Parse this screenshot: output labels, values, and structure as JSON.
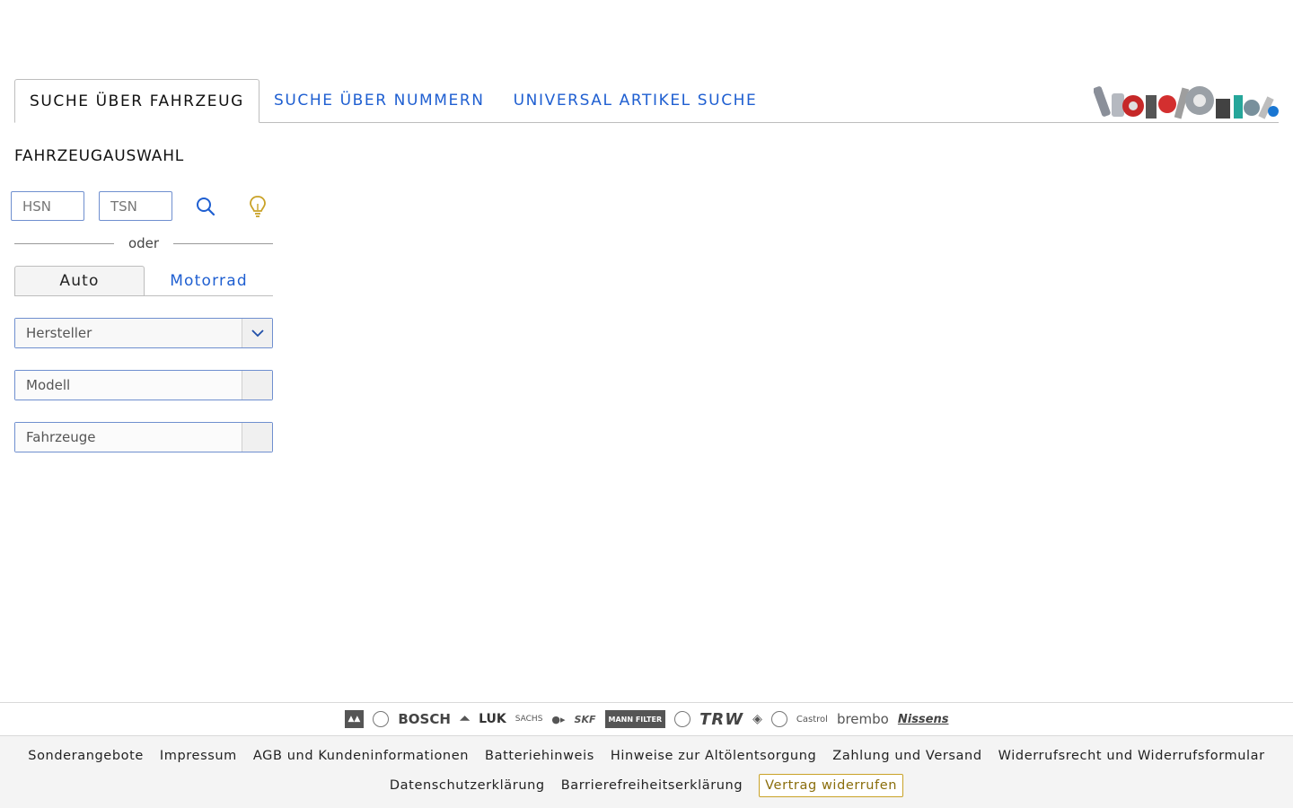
{
  "tabs": [
    {
      "label": "SUCHE ÜBER FAHRZEUG",
      "active": true
    },
    {
      "label": "SUCHE ÜBER NUMMERN",
      "active": false
    },
    {
      "label": "UNIVERSAL ARTIKEL SUCHE",
      "active": false
    }
  ],
  "vehicle": {
    "title": "FAHRZEUGAUSWAHL",
    "hsn_placeholder": "HSN",
    "tsn_placeholder": "TSN",
    "divider_text": "oder",
    "segments": [
      {
        "label": "Auto",
        "active": true
      },
      {
        "label": "Motorrad",
        "active": false
      }
    ],
    "selects": [
      {
        "label": "Hersteller",
        "enabled": true
      },
      {
        "label": "Modell",
        "enabled": false
      },
      {
        "label": "Fahrzeuge",
        "enabled": false
      }
    ]
  },
  "brands": [
    "BOSCH",
    "LUK",
    "SACHS",
    "SKF",
    "MANN FILTER",
    "TRW",
    "Castrol",
    "brembo",
    "Nissens"
  ],
  "footer": {
    "row1": [
      "Sonderangebote",
      "Impressum",
      "AGB und Kundeninformationen",
      "Batteriehinweis",
      "Hinweise zur Altölentsorgung",
      "Zahlung und Versand",
      "Widerrufsrecht und Widerrufsformular"
    ],
    "row2": [
      "Datenschutzerklärung",
      "Barrierefreiheitserklärung"
    ],
    "revoke_button": "Vertrag widerrufen"
  },
  "colors": {
    "link": "#1f5fd1",
    "accent": "#c9a227",
    "border": "#6f8fcf"
  },
  "icons": {
    "search": "search-icon",
    "hint": "lightbulb-icon",
    "chevron": "chevron-down-icon",
    "banner": "auto-parts-banner"
  }
}
